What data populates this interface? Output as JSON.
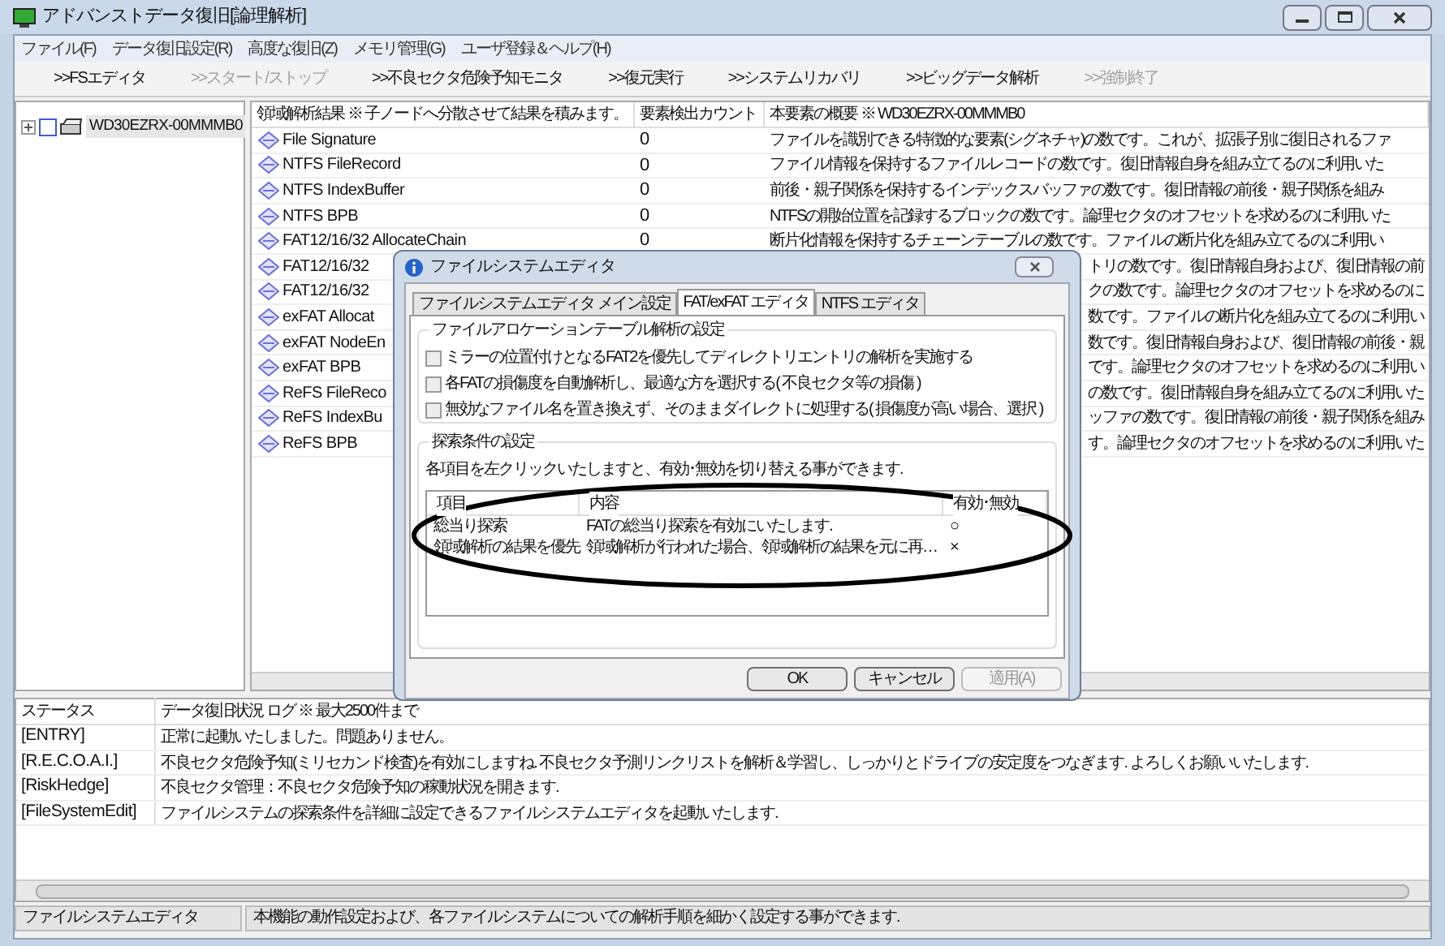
{
  "window": {
    "title": "アドバンストデータ復旧[論理解析]"
  },
  "menu": [
    "ファイル(F)",
    "データ復旧設定(R)",
    "高度な復旧(Z)",
    "メモリ管理(G)",
    "ユーザ登録＆ヘルプ(H)"
  ],
  "toolbar": [
    {
      "label": ">>FSエディタ",
      "disabled": false
    },
    {
      "label": ">>スタート/ストップ",
      "disabled": true
    },
    {
      "label": ">>不良セクタ危険予知モニタ",
      "disabled": false
    },
    {
      "label": ">>復元実行",
      "disabled": false
    },
    {
      "label": ">>システムリカバリ",
      "disabled": false
    },
    {
      "label": ">>ビッグデータ解析",
      "disabled": false
    },
    {
      "label": ">>強制終了",
      "disabled": true
    }
  ],
  "tree": {
    "items": [
      {
        "label": "WD30EZRX-00MMMB0",
        "checked": false,
        "selected": true
      }
    ]
  },
  "table": {
    "columns": [
      "領域解析結果 ※ 子ノードへ分散させて結果を積みます。",
      "要素検出カウント",
      "本要素の概要 ※ WD30EZRX-00MMMB0"
    ],
    "rows": [
      {
        "name": "File Signature",
        "count": "0",
        "summary": "ファイルを識別できる特徴的な要素(シグネチャ)の数です。これが、拡張子別に復旧されるファ"
      },
      {
        "name": "NTFS FileRecord",
        "count": "0",
        "summary": "ファイル情報を保持するファイルレコードの数です。復旧情報自身を組み立てるのに利用いた"
      },
      {
        "name": "NTFS IndexBuffer",
        "count": "0",
        "summary": "前後・親子関係を保持するインデックスバッファの数です。復旧情報の前後・親子関係を組み"
      },
      {
        "name": "NTFS BPB",
        "count": "0",
        "summary": "NTFSの開始位置を記録するブロックの数です。論理セクタのオフセットを求めるのに利用いた"
      },
      {
        "name": "FAT12/16/32 AllocateChain",
        "count": "0",
        "summary": "断片化情報を保持するチェーンテーブルの数です。ファイルの断片化を組み立てるのに利用い"
      },
      {
        "name": "FAT12/16/32",
        "summary": "トリの数です。復旧情報自身および、復旧情報の前"
      },
      {
        "name": "FAT12/16/32",
        "summary": "クの数です。論理セクタのオフセットを求めるのに"
      },
      {
        "name": "exFAT Allocat",
        "summary": "数です。ファイルの断片化を組み立てるのに利用い"
      },
      {
        "name": "exFAT NodeEn",
        "summary": "数です。復旧情報自身および、復旧情報の前後・親"
      },
      {
        "name": "exFAT BPB",
        "summary": "です。論理セクタのオフセットを求めるのに利用い"
      },
      {
        "name": "ReFS FileReco",
        "summary": "の数です。復旧情報自身を組み立てるのに利用いた"
      },
      {
        "name": "ReFS IndexBu",
        "summary": "ッファの数です。復旧情報の前後・親子関係を組み"
      },
      {
        "name": "ReFS BPB",
        "summary": "す。論理セクタのオフセットを求めるのに利用いた"
      }
    ]
  },
  "log": {
    "columns": [
      "ステータス",
      "データ復旧状況 ログ ※ 最大2500件まで"
    ],
    "rows": [
      {
        "status": "[ENTRY]",
        "message": "正常に起動いたしました。問題ありません。"
      },
      {
        "status": "[R.E.C.O.A.I.]",
        "message": "不良セクタ危険予知(ミリセカンド検査)を有効にしますね. 不良セクタ予測リンクリストを解析＆学習し、しっかりとドライブの安定度をつなぎます. よろしくお願いいたします."
      },
      {
        "status": "[RiskHedge]",
        "message": "不良セクタ管理：不良セクタ危険予知の稼動状況を開きます."
      },
      {
        "status": "[FileSystemEdit]",
        "message": "ファイルシステムの探索条件を詳細に設定できるファイルシステムエディタを起動いたします."
      }
    ]
  },
  "status_bar": [
    "ファイルシステムエディタ",
    "本機能の動作設定および、各ファイルシステムについての解析手順を細かく設定する事ができます."
  ],
  "dialog": {
    "title": "ファイルシステムエディタ",
    "tabs": [
      {
        "label": "ファイルシステムエディタ メイン設定",
        "selected": false
      },
      {
        "label": "FAT/exFAT エディタ",
        "selected": true
      },
      {
        "label": "NTFS エディタ",
        "selected": false
      }
    ],
    "group_1": {
      "title": "ファイルアロケーションテーブル解析の設定",
      "options": [
        {
          "label": "ミラーの位置付けとなるFAT2を優先してディレクトリエントリの解析を実施する",
          "checked": false
        },
        {
          "label": "各FATの損傷度を自動解析し、最適な方を選択する( 不良セクタ等の損傷 )",
          "checked": false
        },
        {
          "label": "無効なファイル名を置き換えず、そのままダイレクトに処理する( 損傷度が高い場合、選択 )",
          "checked": false
        }
      ]
    },
    "group_2": {
      "title": "探索条件の設定",
      "hint": "各項目を左クリックいたしますと、有効･無効を切り替える事ができます.",
      "columns": [
        "項目",
        "内容",
        "有効･無効"
      ],
      "rows": [
        {
          "item": "総当り探索",
          "content": "FATの総当り探索を有効にいたします.",
          "state": "○"
        },
        {
          "item": "領域解析の結果を優先",
          "content": "領域解析が行われた場合、領域解析の結果を元に再…",
          "state": "×"
        }
      ]
    },
    "buttons": [
      {
        "label": "OK",
        "disabled": false
      },
      {
        "label": "キャンセル",
        "disabled": false
      },
      {
        "label": "適用(A)",
        "disabled": true
      }
    ]
  }
}
